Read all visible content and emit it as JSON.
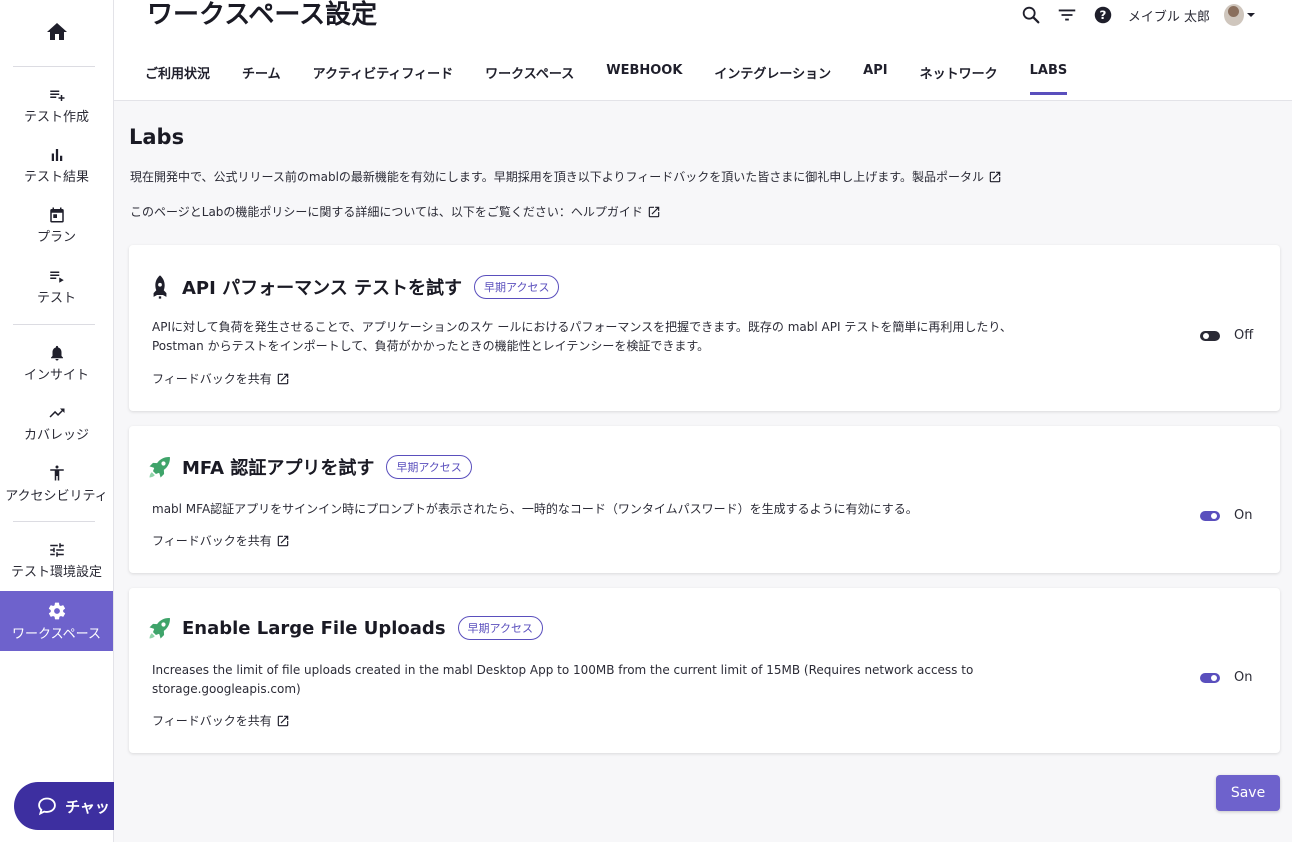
{
  "sidebar": {
    "home_icon": "home-icon",
    "items": [
      {
        "label": "テスト作成",
        "icon": "playlist-add-icon"
      },
      {
        "label": "テスト結果",
        "icon": "bar-chart-icon"
      },
      {
        "label": "プラン",
        "icon": "calendar-icon"
      },
      {
        "label": "テスト",
        "icon": "list-play-icon"
      },
      {
        "label": "インサイト",
        "icon": "bell-icon"
      },
      {
        "label": "カバレッジ",
        "icon": "trending-up-icon"
      },
      {
        "label": "アクセシビリティ",
        "icon": "accessibility-icon"
      },
      {
        "label": "テスト環境設定",
        "icon": "tune-icon"
      },
      {
        "label": "ワークスペース",
        "icon": "gear-icon",
        "active": true
      }
    ],
    "chat_label": "チャット"
  },
  "header": {
    "title": "ワークスペース設定",
    "user_name": "メイブル 太郎",
    "tabs": [
      {
        "label": "ご利用状況"
      },
      {
        "label": "チーム"
      },
      {
        "label": "アクティビティフィード"
      },
      {
        "label": "ワークスペース"
      },
      {
        "label": "WEBHOOK"
      },
      {
        "label": "インテグレーション"
      },
      {
        "label": "API"
      },
      {
        "label": "ネットワーク"
      },
      {
        "label": "LABS",
        "active": true
      }
    ]
  },
  "main": {
    "title": "Labs",
    "intro1": "現在開発中で、公式リリース前のmablの最新機能を有効にします。早期採用を頂き以下よりフィードバックを頂いた皆さまに御礼申し上げます。製品ポータル",
    "intro2": "このページとLabの機能ポリシーに関する詳細については、以下をご覧ください：ヘルプガイド",
    "cards": [
      {
        "title": "API パフォーマンス テストを試す",
        "badge": "早期アクセス",
        "desc_line1": "APIに対して負荷を発生させることで、アプリケーションのスケ ールにおけるパフォーマンスを把握できます。既存の mabl API テストを簡単に再利用したり、",
        "desc_line2": "Postman からテストをインポートして、負荷がかかったときの機能性とレイテンシーを検証できます。",
        "feedback": "フィードバックを共有",
        "state": "Off"
      },
      {
        "title": "MFA 認証アプリを試す",
        "badge": "早期アクセス",
        "desc_line1": "mabl MFA認証アプリをサインイン時にプロンプトが表示されたら、一時的なコード（ワンタイムパスワード）を生成するように有効にする。",
        "feedback": "フィードバックを共有",
        "state": "On"
      },
      {
        "title": "Enable Large File Uploads",
        "badge": "早期アクセス",
        "desc_line1": "Increases the limit of file uploads created in the mabl Desktop App to 100MB from the current limit of 15MB (Requires network access to",
        "desc_line2": "storage.googleapis.com)",
        "feedback": "フィードバックを共有",
        "state": "On"
      }
    ],
    "save_label": "Save"
  },
  "colors": {
    "accent": "#5a4fbd",
    "sidebar_active": "#6e62cc",
    "chat": "#3d2fa0"
  }
}
